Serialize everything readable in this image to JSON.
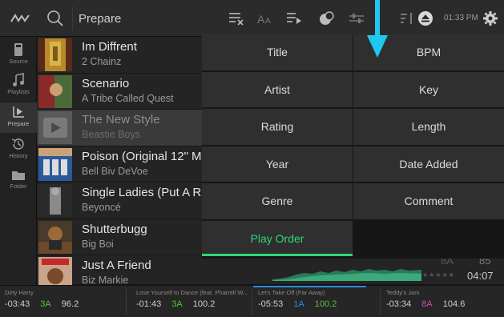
{
  "header": {
    "title": "Prepare",
    "time": "01:33 PM",
    "icons": [
      "djay-logo-icon",
      "search-icon",
      "clear-list-icon",
      "text-size-icon",
      "add-to-queue-icon",
      "automix-icon",
      "settings-sliders-icon",
      "sort-icon",
      "eject-icon",
      "gear-icon"
    ]
  },
  "sidebar": {
    "items": [
      {
        "label": "Source",
        "icon": "device-icon"
      },
      {
        "label": "Playlists",
        "icon": "music-note-icon"
      },
      {
        "label": "Prepare",
        "icon": "prepare-icon"
      },
      {
        "label": "History",
        "icon": "history-icon"
      },
      {
        "label": "Folder",
        "icon": "folder-icon"
      }
    ]
  },
  "tracks": [
    {
      "title": "Im Diffrent",
      "artist": "2 Chainz"
    },
    {
      "title": "Scenario",
      "artist": "A Tribe Called Quest"
    },
    {
      "title": "The New Style",
      "artist": "Beastie Boys"
    },
    {
      "title": "Poison (Original 12\" M",
      "artist": "Bell Biv DeVoe"
    },
    {
      "title": "Single Ladies (Put A R",
      "artist": "Beyoncé"
    },
    {
      "title": "Shutterbugg",
      "artist": "Big Boi"
    },
    {
      "title": "Just A Friend",
      "artist": "Biz Markie"
    }
  ],
  "last_track_meta": {
    "key": "8A",
    "bpm": "85",
    "length": "04:07"
  },
  "sort_menu": {
    "left": [
      "Title",
      "Artist",
      "Rating",
      "Year",
      "Genre",
      "Play Order"
    ],
    "right": [
      "BPM",
      "Key",
      "Length",
      "Date Added",
      "Comment"
    ],
    "active": "Play Order",
    "accent": "#2ed87a"
  },
  "decks": [
    {
      "name": "Dirty Harry",
      "time": "-03:43",
      "key": "3A",
      "bpm": "96.2",
      "progress": 0.0
    },
    {
      "name": "Lose Yourself to Dance (feat. Pharrell W...",
      "time": "-01:43",
      "key": "3A",
      "bpm": "100.2",
      "progress": 0.0
    },
    {
      "name": "Let's Take Off (Far Away)",
      "time": "-05:53",
      "key": "1A",
      "bpm": "100.2",
      "progress": 0.9
    },
    {
      "name": "Teddy's Jam",
      "time": "-03:34",
      "key": "8A",
      "bpm": "104.6",
      "progress": 0.0
    }
  ],
  "colors": {
    "arrow": "#1ec8f0",
    "key_green": "#54c33a",
    "key_pink": "#c94fae"
  }
}
